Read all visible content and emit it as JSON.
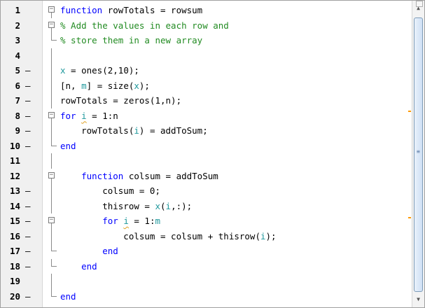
{
  "editor": {
    "lines": [
      {
        "num": "1",
        "bp": "",
        "fold": "open",
        "segments": [
          {
            "t": "function",
            "c": "kw"
          },
          {
            "t": " rowTotals = rowsum",
            "c": ""
          }
        ]
      },
      {
        "num": "2",
        "bp": "",
        "fold": "open",
        "segments": [
          {
            "t": "% Add the values in each row and",
            "c": "cm"
          }
        ]
      },
      {
        "num": "3",
        "bp": "",
        "fold": "end",
        "segments": [
          {
            "t": "% store them in a new array",
            "c": "cm"
          }
        ]
      },
      {
        "num": "4",
        "bp": "",
        "fold": "line",
        "segments": []
      },
      {
        "num": "5",
        "bp": "–",
        "fold": "line",
        "segments": [
          {
            "t": "x",
            "c": "var"
          },
          {
            "t": " = ones(2,10);",
            "c": ""
          }
        ]
      },
      {
        "num": "6",
        "bp": "–",
        "fold": "line",
        "segments": [
          {
            "t": "[n, ",
            "c": ""
          },
          {
            "t": "m",
            "c": "var"
          },
          {
            "t": "] = size(",
            "c": ""
          },
          {
            "t": "x",
            "c": "var"
          },
          {
            "t": ");",
            "c": ""
          }
        ]
      },
      {
        "num": "7",
        "bp": "–",
        "fold": "line",
        "segments": [
          {
            "t": "rowTotals = zeros(1,n);",
            "c": ""
          }
        ]
      },
      {
        "num": "8",
        "bp": "–",
        "fold": "open",
        "segments": [
          {
            "t": "for",
            "c": "kw"
          },
          {
            "t": " ",
            "c": ""
          },
          {
            "t": "i",
            "c": "var uline"
          },
          {
            "t": " = 1:n",
            "c": ""
          }
        ]
      },
      {
        "num": "9",
        "bp": "–",
        "fold": "line",
        "segments": [
          {
            "t": "    rowTotals(",
            "c": ""
          },
          {
            "t": "i",
            "c": "var"
          },
          {
            "t": ") = addToSum;",
            "c": ""
          }
        ]
      },
      {
        "num": "10",
        "bp": "–",
        "fold": "end",
        "segments": [
          {
            "t": "end",
            "c": "kw"
          }
        ]
      },
      {
        "num": "11",
        "bp": "",
        "fold": "line",
        "segments": []
      },
      {
        "num": "12",
        "bp": "",
        "fold": "open",
        "segments": [
          {
            "t": "    ",
            "c": ""
          },
          {
            "t": "function",
            "c": "kw"
          },
          {
            "t": " colsum = addToSum",
            "c": ""
          }
        ]
      },
      {
        "num": "13",
        "bp": "–",
        "fold": "line",
        "segments": [
          {
            "t": "        colsum = 0;",
            "c": ""
          }
        ]
      },
      {
        "num": "14",
        "bp": "–",
        "fold": "line",
        "segments": [
          {
            "t": "        thisrow = ",
            "c": ""
          },
          {
            "t": "x",
            "c": "var"
          },
          {
            "t": "(",
            "c": ""
          },
          {
            "t": "i",
            "c": "var"
          },
          {
            "t": ",:);",
            "c": ""
          }
        ]
      },
      {
        "num": "15",
        "bp": "–",
        "fold": "open",
        "segments": [
          {
            "t": "        ",
            "c": ""
          },
          {
            "t": "for",
            "c": "kw"
          },
          {
            "t": " ",
            "c": ""
          },
          {
            "t": "i",
            "c": "var uline"
          },
          {
            "t": " = 1:",
            "c": ""
          },
          {
            "t": "m",
            "c": "var"
          }
        ]
      },
      {
        "num": "16",
        "bp": "–",
        "fold": "line",
        "segments": [
          {
            "t": "            colsum = colsum + thisrow(",
            "c": ""
          },
          {
            "t": "i",
            "c": "var"
          },
          {
            "t": ");",
            "c": ""
          }
        ]
      },
      {
        "num": "17",
        "bp": "–",
        "fold": "end",
        "segments": [
          {
            "t": "        ",
            "c": ""
          },
          {
            "t": "end",
            "c": "kw"
          }
        ]
      },
      {
        "num": "18",
        "bp": "–",
        "fold": "end",
        "segments": [
          {
            "t": "    ",
            "c": ""
          },
          {
            "t": "end",
            "c": "kw"
          }
        ]
      },
      {
        "num": "19",
        "bp": "",
        "fold": "line",
        "segments": []
      },
      {
        "num": "20",
        "bp": "–",
        "fold": "end",
        "segments": [
          {
            "t": "end",
            "c": "kw"
          }
        ]
      }
    ]
  },
  "colors": {
    "keyword": "#0000ff",
    "comment": "#228b22",
    "variable": "#20999d",
    "warning_mark": "#ff9a00"
  },
  "scrollbar": {
    "up_icon": "triangle-up",
    "down_icon": "triangle-down",
    "warning_marks": 3
  }
}
